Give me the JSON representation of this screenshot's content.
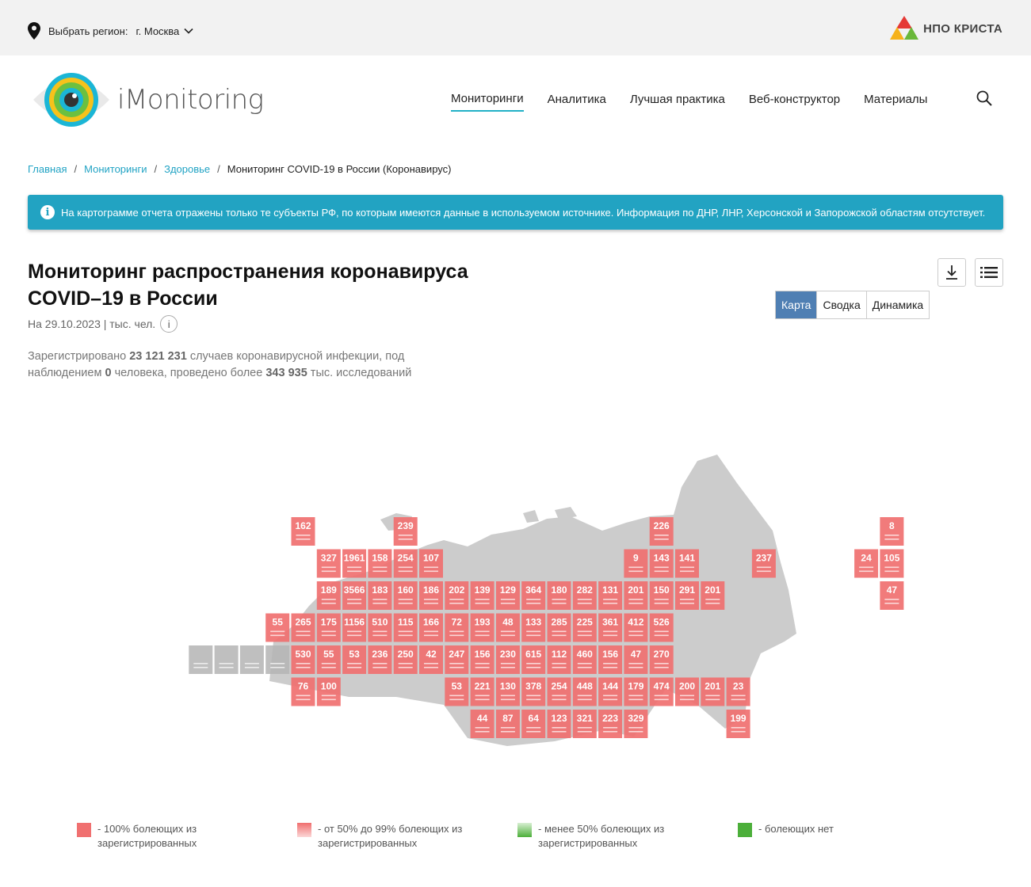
{
  "topbar": {
    "region_label": "Выбрать регион:",
    "region_value": "г. Москва",
    "brand": "НПО КРИСТА"
  },
  "header": {
    "logo_text": "iMonitoring",
    "nav": [
      {
        "label": "Мониторинги",
        "active": true
      },
      {
        "label": "Аналитика",
        "active": false
      },
      {
        "label": "Лучшая практика",
        "active": false
      },
      {
        "label": "Веб-конструктор",
        "active": false
      },
      {
        "label": "Материалы",
        "active": false
      }
    ]
  },
  "breadcrumb": {
    "items": [
      "Главная",
      "Мониторинги",
      "Здоровье"
    ],
    "current": "Мониторинг COVID-19 в России (Коронавирус)"
  },
  "notice": {
    "text": "На картограмме отчета отражены только те субъекты РФ, по которым имеются данные в используемом источнике. Информация по ДНР, ЛНР, Херсонской и Запорожской областям отсутствует."
  },
  "report": {
    "title_line1": "Мониторинг распространения коронавируса",
    "title_line2": "COVID–19 в России",
    "date_unit": "На 29.10.2023 | тыс. чел.",
    "summary_prefix": "Зарегистрировано",
    "registered": "23 121 231",
    "summary_mid1": "случаев коронавирусной инфекции, под наблюдением",
    "observed": "0",
    "summary_mid2": "человека, проведено более",
    "tests": "343 935",
    "summary_suffix": "тыс. исследований"
  },
  "tabs": [
    {
      "label": "Карта",
      "active": true
    },
    {
      "label": "Сводка",
      "active": false
    },
    {
      "label": "Динамика",
      "active": false
    }
  ],
  "icons": {
    "download": "download-icon",
    "list": "list-icon",
    "search": "search-icon",
    "info": "info-icon",
    "pin": "location-pin-icon"
  },
  "colors": {
    "accent": "#21a3c4",
    "tile_full": "#f07070",
    "tile_partial": "#f6a7a7",
    "tile_less": "#7cc36e",
    "tile_none": "#4caf3a",
    "tile_nodata": "#b4b4b4",
    "map_bg": "#cccccc",
    "tab_active": "#4f7fb3"
  },
  "map": {
    "rows": [
      [
        {
          "col": 5,
          "v": "162"
        },
        {
          "col": 9,
          "v": "239"
        },
        {
          "col": 19,
          "v": "226"
        },
        {
          "col": 28,
          "v": "8"
        }
      ],
      [
        {
          "col": 6,
          "v": "327"
        },
        {
          "col": 7,
          "v": "1961"
        },
        {
          "col": 8,
          "v": "158"
        },
        {
          "col": 9,
          "v": "254"
        },
        {
          "col": 10,
          "v": "107"
        },
        {
          "col": 18,
          "v": "9"
        },
        {
          "col": 19,
          "v": "143"
        },
        {
          "col": 20,
          "v": "141"
        },
        {
          "col": 23,
          "v": "237"
        },
        {
          "col": 27,
          "v": "24"
        },
        {
          "col": 28,
          "v": "105"
        }
      ],
      [
        {
          "col": 6,
          "v": "189"
        },
        {
          "col": 7,
          "v": "3566"
        },
        {
          "col": 8,
          "v": "183"
        },
        {
          "col": 9,
          "v": "160"
        },
        {
          "col": 10,
          "v": "186"
        },
        {
          "col": 11,
          "v": "202"
        },
        {
          "col": 12,
          "v": "139"
        },
        {
          "col": 13,
          "v": "129"
        },
        {
          "col": 14,
          "v": "364"
        },
        {
          "col": 15,
          "v": "180"
        },
        {
          "col": 16,
          "v": "282"
        },
        {
          "col": 17,
          "v": "131"
        },
        {
          "col": 18,
          "v": "201"
        },
        {
          "col": 19,
          "v": "150"
        },
        {
          "col": 20,
          "v": "291"
        },
        {
          "col": 21,
          "v": "201"
        },
        {
          "col": 28,
          "v": "47"
        }
      ],
      [
        {
          "col": 4,
          "v": "55"
        },
        {
          "col": 5,
          "v": "265"
        },
        {
          "col": 6,
          "v": "175"
        },
        {
          "col": 7,
          "v": "1156"
        },
        {
          "col": 8,
          "v": "510"
        },
        {
          "col": 9,
          "v": "115"
        },
        {
          "col": 10,
          "v": "166"
        },
        {
          "col": 11,
          "v": "72"
        },
        {
          "col": 12,
          "v": "193"
        },
        {
          "col": 13,
          "v": "48"
        },
        {
          "col": 14,
          "v": "133"
        },
        {
          "col": 15,
          "v": "285"
        },
        {
          "col": 16,
          "v": "225"
        },
        {
          "col": 17,
          "v": "361"
        },
        {
          "col": 18,
          "v": "412"
        },
        {
          "col": 19,
          "v": "526"
        }
      ],
      [
        {
          "col": 1,
          "v": "",
          "nodata": true
        },
        {
          "col": 2,
          "v": "",
          "nodata": true
        },
        {
          "col": 3,
          "v": "",
          "nodata": true
        },
        {
          "col": 4,
          "v": "",
          "nodata": true
        },
        {
          "col": 5,
          "v": "530"
        },
        {
          "col": 6,
          "v": "55"
        },
        {
          "col": 7,
          "v": "53"
        },
        {
          "col": 8,
          "v": "236"
        },
        {
          "col": 9,
          "v": "250"
        },
        {
          "col": 10,
          "v": "42"
        },
        {
          "col": 11,
          "v": "247"
        },
        {
          "col": 12,
          "v": "156"
        },
        {
          "col": 13,
          "v": "230"
        },
        {
          "col": 14,
          "v": "615"
        },
        {
          "col": 15,
          "v": "112"
        },
        {
          "col": 16,
          "v": "460"
        },
        {
          "col": 17,
          "v": "156"
        },
        {
          "col": 18,
          "v": "47"
        },
        {
          "col": 19,
          "v": "270"
        }
      ],
      [
        {
          "col": 5,
          "v": "76"
        },
        {
          "col": 6,
          "v": "100"
        },
        {
          "col": 11,
          "v": "53"
        },
        {
          "col": 12,
          "v": "221"
        },
        {
          "col": 13,
          "v": "130"
        },
        {
          "col": 14,
          "v": "378"
        },
        {
          "col": 15,
          "v": "254"
        },
        {
          "col": 16,
          "v": "448"
        },
        {
          "col": 17,
          "v": "144"
        },
        {
          "col": 18,
          "v": "179"
        },
        {
          "col": 19,
          "v": "474"
        },
        {
          "col": 20,
          "v": "200"
        },
        {
          "col": 21,
          "v": "201"
        },
        {
          "col": 22,
          "v": "23"
        }
      ],
      [
        {
          "col": 12,
          "v": "44"
        },
        {
          "col": 13,
          "v": "87"
        },
        {
          "col": 14,
          "v": "64"
        },
        {
          "col": 15,
          "v": "123"
        },
        {
          "col": 16,
          "v": "321"
        },
        {
          "col": 17,
          "v": "223"
        },
        {
          "col": 18,
          "v": "329"
        },
        {
          "col": 22,
          "v": "199"
        }
      ]
    ]
  },
  "legend": [
    {
      "line1": "- 100% болеющих из",
      "line2": "зарегистрированных",
      "color": "#f07070"
    },
    {
      "line1": "- от 50% до 99% болеющих из",
      "line2": "зарегистрированных",
      "color": "#f8b8b8"
    },
    {
      "line1": "- менее 50% болеющих из",
      "line2": "зарегистрированных",
      "color": "#7cc36e"
    },
    {
      "line1": "- болеющих нет",
      "line2": "",
      "color": "#4caf3a"
    }
  ]
}
